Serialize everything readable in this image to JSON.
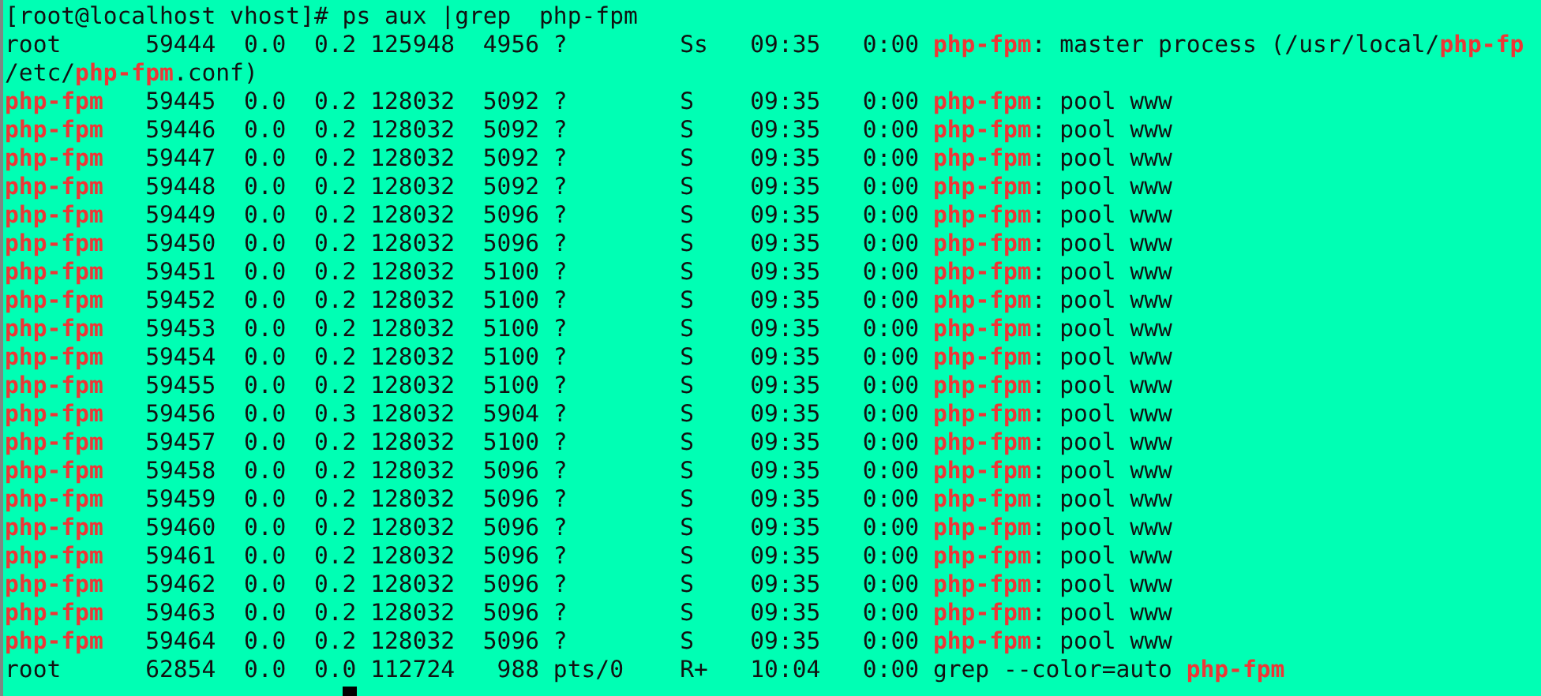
{
  "terminal": {
    "lines": [
      {
        "segments": [
          {
            "text": "[root@localhost vhost]# ps aux |grep  php-fpm",
            "match": false
          }
        ]
      },
      {
        "segments": [
          {
            "text": "root      59444  0.0  0.2 125948  4956 ?        Ss   09:35   0:00 ",
            "match": false
          },
          {
            "text": "php-fpm",
            "match": true
          },
          {
            "text": ": master process (/usr/local/",
            "match": false
          },
          {
            "text": "php-fp",
            "match": true
          }
        ]
      },
      {
        "segments": [
          {
            "text": "/etc/",
            "match": false
          },
          {
            "text": "php-fpm",
            "match": true
          },
          {
            "text": ".conf)",
            "match": false
          }
        ]
      },
      {
        "segments": [
          {
            "text": "php-fpm",
            "match": true
          },
          {
            "text": "   59445  0.0  0.2 128032  5092 ?        S    09:35   0:00 ",
            "match": false
          },
          {
            "text": "php-fpm",
            "match": true
          },
          {
            "text": ": pool www",
            "match": false
          }
        ]
      },
      {
        "segments": [
          {
            "text": "php-fpm",
            "match": true
          },
          {
            "text": "   59446  0.0  0.2 128032  5092 ?        S    09:35   0:00 ",
            "match": false
          },
          {
            "text": "php-fpm",
            "match": true
          },
          {
            "text": ": pool www",
            "match": false
          }
        ]
      },
      {
        "segments": [
          {
            "text": "php-fpm",
            "match": true
          },
          {
            "text": "   59447  0.0  0.2 128032  5092 ?        S    09:35   0:00 ",
            "match": false
          },
          {
            "text": "php-fpm",
            "match": true
          },
          {
            "text": ": pool www",
            "match": false
          }
        ]
      },
      {
        "segments": [
          {
            "text": "php-fpm",
            "match": true
          },
          {
            "text": "   59448  0.0  0.2 128032  5092 ?        S    09:35   0:00 ",
            "match": false
          },
          {
            "text": "php-fpm",
            "match": true
          },
          {
            "text": ": pool www",
            "match": false
          }
        ]
      },
      {
        "segments": [
          {
            "text": "php-fpm",
            "match": true
          },
          {
            "text": "   59449  0.0  0.2 128032  5096 ?        S    09:35   0:00 ",
            "match": false
          },
          {
            "text": "php-fpm",
            "match": true
          },
          {
            "text": ": pool www",
            "match": false
          }
        ]
      },
      {
        "segments": [
          {
            "text": "php-fpm",
            "match": true
          },
          {
            "text": "   59450  0.0  0.2 128032  5096 ?        S    09:35   0:00 ",
            "match": false
          },
          {
            "text": "php-fpm",
            "match": true
          },
          {
            "text": ": pool www",
            "match": false
          }
        ]
      },
      {
        "segments": [
          {
            "text": "php-fpm",
            "match": true
          },
          {
            "text": "   59451  0.0  0.2 128032  5100 ?        S    09:35   0:00 ",
            "match": false
          },
          {
            "text": "php-fpm",
            "match": true
          },
          {
            "text": ": pool www",
            "match": false
          }
        ]
      },
      {
        "segments": [
          {
            "text": "php-fpm",
            "match": true
          },
          {
            "text": "   59452  0.0  0.2 128032  5100 ?        S    09:35   0:00 ",
            "match": false
          },
          {
            "text": "php-fpm",
            "match": true
          },
          {
            "text": ": pool www",
            "match": false
          }
        ]
      },
      {
        "segments": [
          {
            "text": "php-fpm",
            "match": true
          },
          {
            "text": "   59453  0.0  0.2 128032  5100 ?        S    09:35   0:00 ",
            "match": false
          },
          {
            "text": "php-fpm",
            "match": true
          },
          {
            "text": ": pool www",
            "match": false
          }
        ]
      },
      {
        "segments": [
          {
            "text": "php-fpm",
            "match": true
          },
          {
            "text": "   59454  0.0  0.2 128032  5100 ?        S    09:35   0:00 ",
            "match": false
          },
          {
            "text": "php-fpm",
            "match": true
          },
          {
            "text": ": pool www",
            "match": false
          }
        ]
      },
      {
        "segments": [
          {
            "text": "php-fpm",
            "match": true
          },
          {
            "text": "   59455  0.0  0.2 128032  5100 ?        S    09:35   0:00 ",
            "match": false
          },
          {
            "text": "php-fpm",
            "match": true
          },
          {
            "text": ": pool www",
            "match": false
          }
        ]
      },
      {
        "segments": [
          {
            "text": "php-fpm",
            "match": true
          },
          {
            "text": "   59456  0.0  0.3 128032  5904 ?        S    09:35   0:00 ",
            "match": false
          },
          {
            "text": "php-fpm",
            "match": true
          },
          {
            "text": ": pool www",
            "match": false
          }
        ]
      },
      {
        "segments": [
          {
            "text": "php-fpm",
            "match": true
          },
          {
            "text": "   59457  0.0  0.2 128032  5100 ?        S    09:35   0:00 ",
            "match": false
          },
          {
            "text": "php-fpm",
            "match": true
          },
          {
            "text": ": pool www",
            "match": false
          }
        ]
      },
      {
        "segments": [
          {
            "text": "php-fpm",
            "match": true
          },
          {
            "text": "   59458  0.0  0.2 128032  5096 ?        S    09:35   0:00 ",
            "match": false
          },
          {
            "text": "php-fpm",
            "match": true
          },
          {
            "text": ": pool www",
            "match": false
          }
        ]
      },
      {
        "segments": [
          {
            "text": "php-fpm",
            "match": true
          },
          {
            "text": "   59459  0.0  0.2 128032  5096 ?        S    09:35   0:00 ",
            "match": false
          },
          {
            "text": "php-fpm",
            "match": true
          },
          {
            "text": ": pool www",
            "match": false
          }
        ]
      },
      {
        "segments": [
          {
            "text": "php-fpm",
            "match": true
          },
          {
            "text": "   59460  0.0  0.2 128032  5096 ?        S    09:35   0:00 ",
            "match": false
          },
          {
            "text": "php-fpm",
            "match": true
          },
          {
            "text": ": pool www",
            "match": false
          }
        ]
      },
      {
        "segments": [
          {
            "text": "php-fpm",
            "match": true
          },
          {
            "text": "   59461  0.0  0.2 128032  5096 ?        S    09:35   0:00 ",
            "match": false
          },
          {
            "text": "php-fpm",
            "match": true
          },
          {
            "text": ": pool www",
            "match": false
          }
        ]
      },
      {
        "segments": [
          {
            "text": "php-fpm",
            "match": true
          },
          {
            "text": "   59462  0.0  0.2 128032  5096 ?        S    09:35   0:00 ",
            "match": false
          },
          {
            "text": "php-fpm",
            "match": true
          },
          {
            "text": ": pool www",
            "match": false
          }
        ]
      },
      {
        "segments": [
          {
            "text": "php-fpm",
            "match": true
          },
          {
            "text": "   59463  0.0  0.2 128032  5096 ?        S    09:35   0:00 ",
            "match": false
          },
          {
            "text": "php-fpm",
            "match": true
          },
          {
            "text": ": pool www",
            "match": false
          }
        ]
      },
      {
        "segments": [
          {
            "text": "php-fpm",
            "match": true
          },
          {
            "text": "   59464  0.0  0.2 128032  5096 ?        S    09:35   0:00 ",
            "match": false
          },
          {
            "text": "php-fpm",
            "match": true
          },
          {
            "text": ": pool www",
            "match": false
          }
        ]
      },
      {
        "segments": [
          {
            "text": "root      62854  0.0  0.0 112724   988 pts/0    R+   10:04   0:00 grep --color=auto ",
            "match": false
          },
          {
            "text": "php-fpm",
            "match": true
          }
        ]
      }
    ],
    "cursor": {
      "visible": true
    }
  }
}
